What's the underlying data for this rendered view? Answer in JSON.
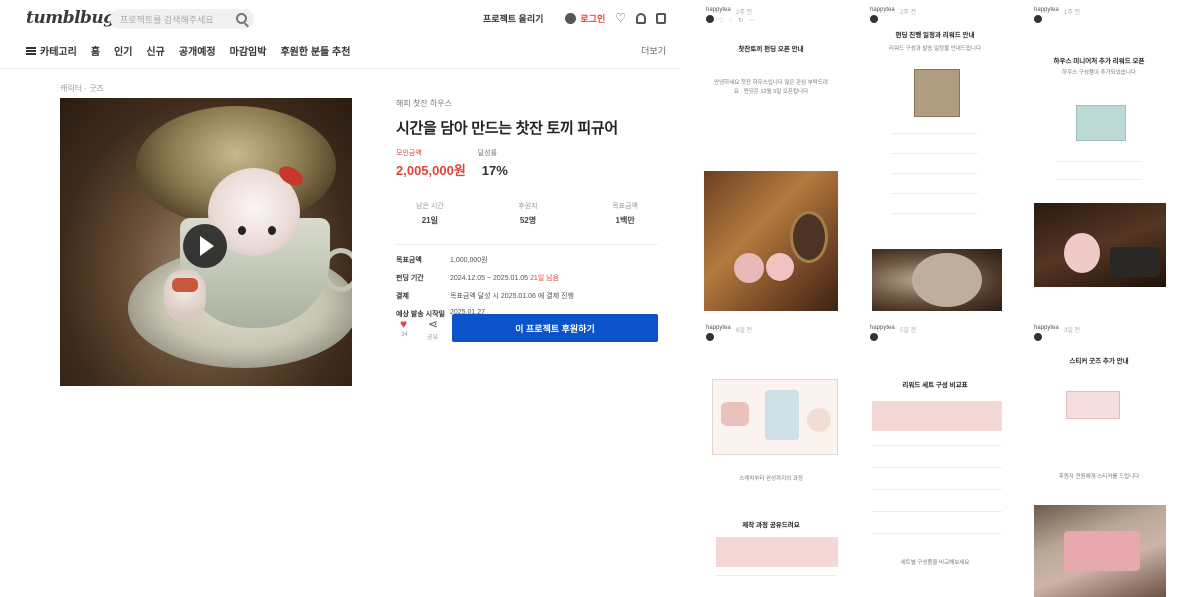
{
  "header": {
    "logo": "tumblbug",
    "search_placeholder": "프로젝트를 검색해주세요",
    "start_project": "프로젝트 올리기",
    "login": "로그인"
  },
  "nav": {
    "items": [
      "카테고리",
      "홈",
      "인기",
      "신규",
      "공개예정",
      "마감임박",
      "후원한 분들 추천"
    ],
    "right": "더보기"
  },
  "product": {
    "breadcrumb": "캐릭터 · 굿즈",
    "brand": "해피 찻잔 하우스",
    "title": "시간을 담아 만드는 찻잔 토끼 피규어",
    "price_label": "모인금액",
    "discount_label": "달성률",
    "price": "2,005,000원",
    "discount": "17%",
    "stats": [
      {
        "label": "남은 시간",
        "value": "21일"
      },
      {
        "label": "후원자",
        "value": "52명"
      },
      {
        "label": "목표금액",
        "value": "1백만"
      }
    ],
    "details": [
      {
        "key": "목표금액",
        "value": "1,000,000원",
        "highlight": ""
      },
      {
        "key": "펀딩 기간",
        "value": "2024.12.05 ~ 2025.01.05",
        "highlight": "21일 남음"
      },
      {
        "key": "결제",
        "value": "목표금액 달성 시 2025.01.06 에 결제 진행",
        "highlight": ""
      },
      {
        "key": "예상 발송 시작일",
        "value": "2025.01.27",
        "highlight": ""
      }
    ],
    "wish_count": "34",
    "share_label": "공유",
    "cta": "이 프로젝트 후원하기"
  },
  "posts": [
    {
      "user": "happytea",
      "time": "2주 전",
      "title": "찻잔토끼 펀딩 오픈 안내",
      "text": "안녕하세요 찻잔 하우스입니다 많은 관심 부탁드려요 · 펀딩은 12월 5일 오픈됩니다"
    },
    {
      "user": "happytea",
      "time": "2주 전",
      "title": "펀딩 진행 일정과 리워드 안내",
      "text": "리워드 구성과 발송 일정을 안내드립니다"
    },
    {
      "user": "happytea",
      "time": "1주 전",
      "title": "하우스 미니어처 추가 리워드 오픈",
      "text": "하우스 구성품이 추가되었습니다"
    },
    {
      "user": "happytea",
      "time": "6일 전",
      "title": "제작 과정 공유드려요",
      "text": "스케치부터 완성까지의 과정"
    },
    {
      "user": "happytea",
      "time": "5일 전",
      "title": "리워드 세트 구성 비교표",
      "text": "세트별 구성품을 비교해보세요"
    },
    {
      "user": "happytea",
      "time": "3일 전",
      "title": "스티커 굿즈 추가 안내",
      "text": "후원자 전원에게 스티커를 드립니다"
    }
  ],
  "colors": {
    "accent": "#e0453b",
    "cta": "#0b53c9"
  }
}
